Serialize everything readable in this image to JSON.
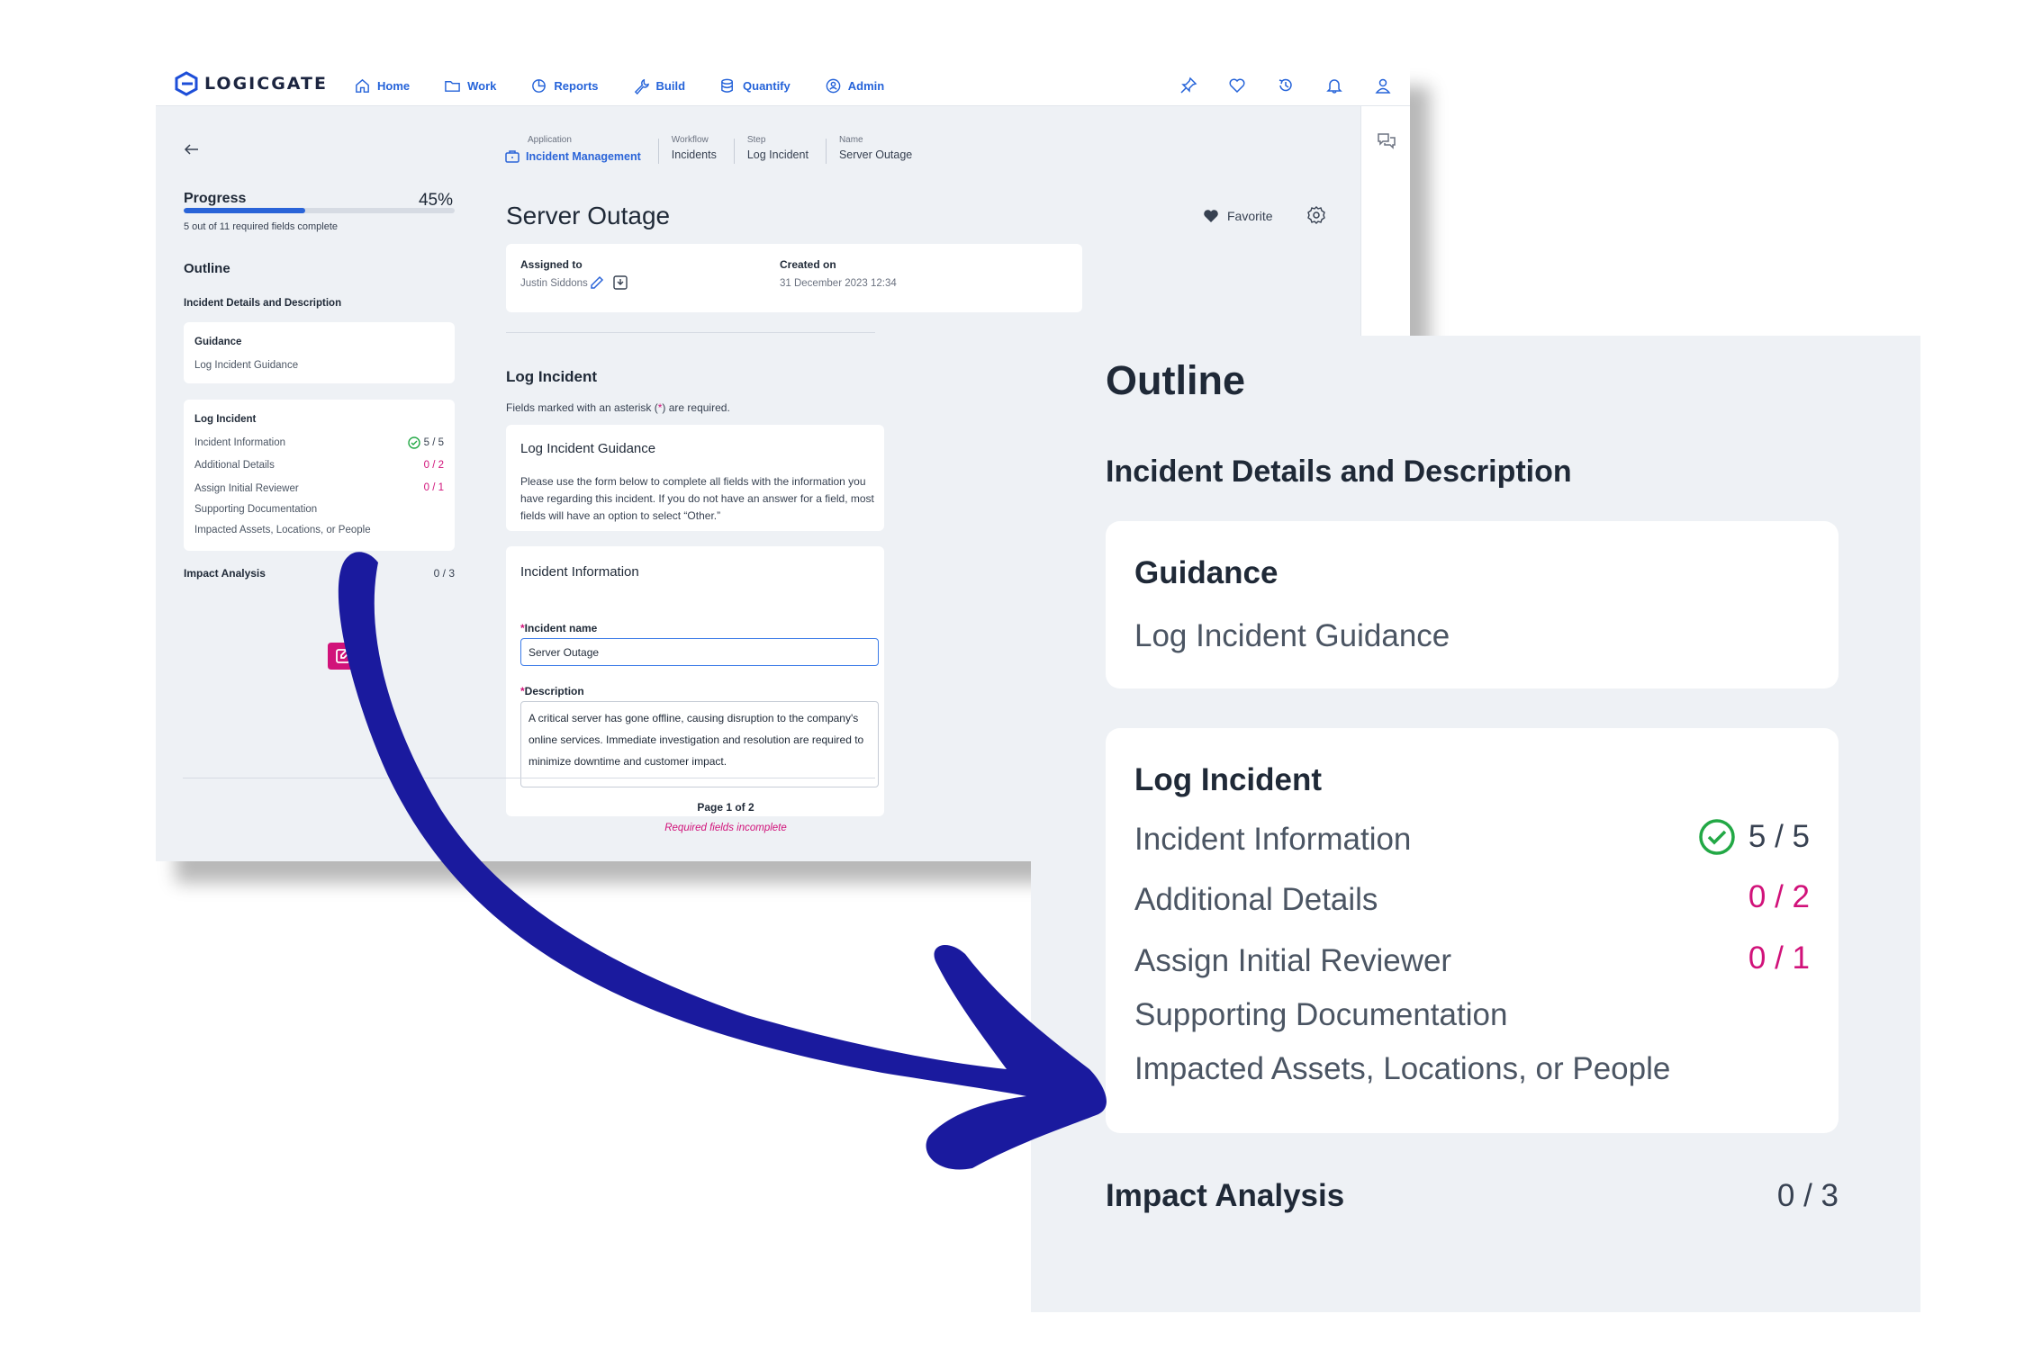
{
  "app": {
    "logo": "LOGICGATE",
    "nav": [
      {
        "label": "Home",
        "icon": "home-icon"
      },
      {
        "label": "Work",
        "icon": "folder-icon"
      },
      {
        "label": "Reports",
        "icon": "chart-icon"
      },
      {
        "label": "Build",
        "icon": "wrench-icon"
      },
      {
        "label": "Quantify",
        "icon": "database-icon"
      },
      {
        "label": "Admin",
        "icon": "shield-user-icon"
      }
    ],
    "header_icons": [
      "pin-icon",
      "heart-icon",
      "history-icon",
      "bell-icon",
      "user-icon"
    ],
    "accent": "#2a64d8",
    "alert_color": "#d1127a"
  },
  "sidebar": {
    "progress_title": "Progress",
    "progress_pct": "45%",
    "progress_value": 0.45,
    "progress_sub": "5 out of 11 required fields complete",
    "outline_title": "Outline",
    "section": "Incident Details and Description",
    "guidance": {
      "title": "Guidance",
      "item": "Log Incident Guidance"
    },
    "log": {
      "title": "Log Incident",
      "items": [
        {
          "label": "Incident Information",
          "value": "5 / 5"
        },
        {
          "label": "Additional Details",
          "value": "0 / 2"
        },
        {
          "label": "Assign Initial Reviewer",
          "value": "0 / 1"
        },
        {
          "label": "Supporting Documentation",
          "value": ""
        },
        {
          "label": "Impacted Assets, Locations, or People",
          "value": ""
        }
      ]
    },
    "impact": {
      "label": "Impact Analysis",
      "value": "0 / 3"
    }
  },
  "breadcrumbs": [
    {
      "key": "Application",
      "value": "Incident Management"
    },
    {
      "key": "Workflow",
      "value": "Incidents"
    },
    {
      "key": "Step",
      "value": "Log Incident"
    },
    {
      "key": "Name",
      "value": "Server Outage"
    }
  ],
  "page_title": "Server Outage",
  "favorite_label": "Favorite",
  "assign": {
    "assigned_label": "Assigned to",
    "assigned_value": "Justin Siddons",
    "created_label": "Created on",
    "created_value": "31 December 2023 12:34"
  },
  "form": {
    "section_title": "Log Incident",
    "required_note_pre": "Fields marked with an asterisk (",
    "required_note_ast": "*",
    "required_note_post": ") are required.",
    "guidance_title": "Log Incident Guidance",
    "guidance_text": "Please use the form below to complete all fields with the information you have regarding this incident. If you do not have an answer for a field, most fields will have an option to select “Other.”",
    "info_title": "Incident Information",
    "name_label": "Incident name",
    "name_value": "Server Outage",
    "desc_label": "Description",
    "desc_value": "A critical server has gone offline, causing disruption to the company's online services. Immediate investigation and resolution are required to minimize downtime and customer impact.",
    "asterisk": "*"
  },
  "footer": {
    "page": "Page 1 of 2",
    "status": "Required fields incomplete"
  },
  "zoom": {
    "outline_title": "Outline",
    "section": "Incident Details and Description",
    "guidance_title": "Guidance",
    "guidance_item": "Log Incident Guidance",
    "log_title": "Log Incident",
    "items": [
      {
        "label": "Incident Information",
        "value": "5 / 5"
      },
      {
        "label": "Additional Details",
        "value": "0 / 2"
      },
      {
        "label": "Assign Initial Reviewer",
        "value": "0 / 1"
      },
      {
        "label": "Supporting Documentation",
        "value": ""
      },
      {
        "label": "Impacted Assets, Locations, or People",
        "value": ""
      }
    ],
    "impact_label": "Impact Analysis",
    "impact_value": "0 / 3"
  },
  "arrow_color": "#1a1a9e"
}
